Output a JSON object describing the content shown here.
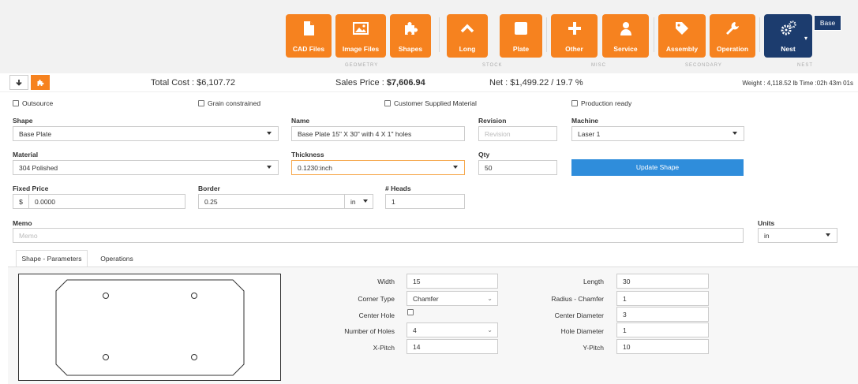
{
  "toolbar": {
    "buttons": [
      {
        "label": "CAD Files",
        "icon": "file-icon"
      },
      {
        "label": "Image Files",
        "icon": "image-icon"
      },
      {
        "label": "Shapes",
        "icon": "puzzle-icon"
      },
      {
        "label": "Long",
        "icon": "chevron-up-icon"
      },
      {
        "label": "Plate",
        "icon": "square-icon"
      },
      {
        "label": "Other",
        "icon": "plus-icon"
      },
      {
        "label": "Service",
        "icon": "person-icon"
      },
      {
        "label": "Assembly",
        "icon": "tag-icon"
      },
      {
        "label": "Operation",
        "icon": "wrench-icon"
      },
      {
        "label": "Nest",
        "icon": "gears-icon"
      }
    ],
    "groups": [
      "GEOMETRY",
      "STOCK",
      "MISC",
      "SECONDARY",
      "NEST"
    ],
    "base_label": "Base"
  },
  "costbar": {
    "total_cost": "Total Cost : $6,107.72",
    "sales_label": "Sales Price : ",
    "sales_value": "$7,606.94",
    "net": "Net : $1,499.22 / 19.7 %",
    "weight": "Weight : 4,118.52 lb Time :02h 43m 01s"
  },
  "checkboxes": {
    "outsource": "Outsource",
    "grain": "Grain constrained",
    "customer_material": "Customer Supplied Material",
    "production_ready": "Production ready"
  },
  "form": {
    "shape_label": "Shape",
    "shape_value": "Base Plate",
    "name_label": "Name",
    "name_value": "Base Plate 15\" X 30\"  with 4 X 1\" holes",
    "revision_label": "Revision",
    "revision_placeholder": "Revision",
    "machine_label": "Machine",
    "machine_value": "Laser 1",
    "material_label": "Material",
    "material_value": "304 Polished",
    "thickness_label": "Thickness",
    "thickness_value": "0.1230:inch",
    "qty_label": "Qty",
    "qty_value": "50",
    "update_label": "Update Shape",
    "fixed_price_label": "Fixed Price",
    "fixed_price_prefix": "$",
    "fixed_price_value": "0.0000",
    "border_label": "Border",
    "border_value": "0.25",
    "border_unit": "in",
    "heads_label": "# Heads",
    "heads_value": "1",
    "memo_label": "Memo",
    "memo_placeholder": "Memo",
    "units_label": "Units",
    "units_value": "in"
  },
  "tabs": {
    "shape_params": "Shape - Parameters",
    "operations": "Operations"
  },
  "params": {
    "width_label": "Width",
    "width_value": "15",
    "length_label": "Length",
    "length_value": "30",
    "corner_type_label": "Corner Type",
    "corner_type_value": "Chamfer",
    "radius_label": "Radius - Chamfer",
    "radius_value": "1",
    "center_hole_label": "Center Hole",
    "center_diameter_label": "Center Diameter",
    "center_diameter_value": "3",
    "num_holes_label": "Number of Holes",
    "num_holes_value": "4",
    "hole_diameter_label": "Hole Diameter",
    "hole_diameter_value": "1",
    "x_pitch_label": "X-Pitch",
    "x_pitch_value": "14",
    "y_pitch_label": "Y-Pitch",
    "y_pitch_value": "10"
  },
  "colors": {
    "accent": "#f6821f",
    "nest": "#1c3c6e",
    "update": "#2f8ddb"
  }
}
